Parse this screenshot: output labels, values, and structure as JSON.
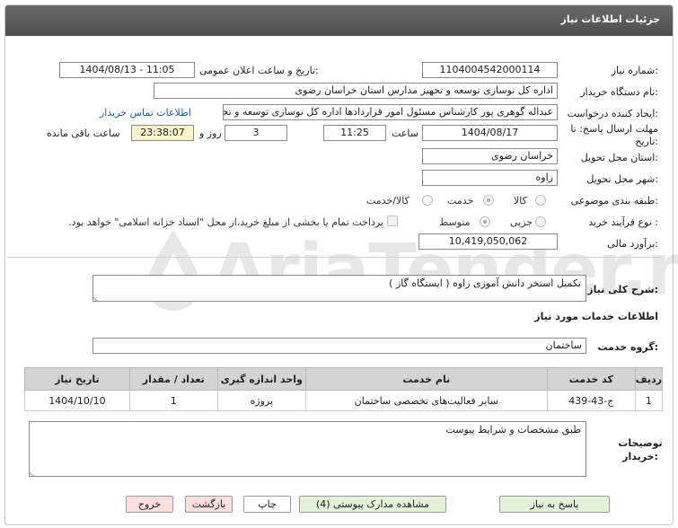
{
  "header": {
    "title": "جزئیات اطلاعات نیاز"
  },
  "form": {
    "need_number_label": "شماره نیاز:",
    "need_number": "1104004542000114",
    "announce_label": "تاریخ و ساعت اعلان عمومی:",
    "announce_value": "1404/08/13 - 11:05",
    "buyer_label": "نام دستگاه خریدار:",
    "buyer_value": "اداره کل نوسازی  توسعه و تجهیز مدارس استان خراسان رضوی",
    "creator_label": "ایجاد کننده درخواست:",
    "creator_value": "عبداله گوهری پور کارشناس مسئول امور قراردادها  اداره کل نوسازی  توسعه و تجهیز مدارس استان خراسان رضوی",
    "contact_link": "اطلاعات تماس خریدار",
    "deadline_label": "مهلت ارسال پاسخ: تا تاریخ:",
    "deadline_date": "1404/08/17",
    "time_label": "ساعت",
    "deadline_time": "11:25",
    "days_value": "3",
    "days_label": "روز و",
    "remaining_time": "23:38:07",
    "remaining_label": "ساعت باقی مانده",
    "province_label": "استان محل تحویل:",
    "province_value": "خراسان رضوی",
    "city_label": "شهر محل تحویل:",
    "city_value": "زاوه",
    "category_label": "طبقه بندی موضوعی:",
    "category_options": [
      "کالا",
      "خدمت",
      "کالا/خدمت"
    ],
    "process_label": "نوع فرآیند خرید :",
    "process_options": [
      "جزیی",
      "متوسط"
    ],
    "payment_note": "پرداخت تمام یا بخشی از مبلغ خرید،از محل \"اسناد خزانه اسلامی\" خواهد بود.",
    "estimate_label": "برآورد مالی:",
    "estimate_value": "10,419,050,062"
  },
  "need_desc": {
    "label": "شرح کلی نیاز:",
    "value": "تکمیل استخر دانش آموزی زاوه ( ایستگاه گاز )"
  },
  "services": {
    "section_title": "اطلاعات خدمات مورد نیاز",
    "group_label": "گروه خدمت:",
    "group_value": "ساختمان",
    "columns": [
      "ردیف",
      "کد خدمت",
      "نام خدمت",
      "واحد اندازه گیری",
      "تعداد / مقدار",
      "تاریخ نیاز"
    ],
    "rows": [
      [
        "1",
        "ج-43-439",
        "سایر فعالیت‌های تخصصی ساختمان",
        "پروژه",
        "1",
        "1404/10/10"
      ]
    ]
  },
  "buyer_notes": {
    "label_line1": "توضیحات",
    "label_line2": "خریدار:",
    "value": "طبق مشخصات و شرایط پیوست"
  },
  "buttons": {
    "reply": "پاسخ به نیاز",
    "attachments": "مشاهده مدارک پیوستی (4)",
    "print": "چاپ",
    "back": "بازگشت",
    "exit": "خروج"
  },
  "watermark": "AriaTender.net",
  "colors": {
    "header_bg": "#555555",
    "link": "#1a5fb4",
    "yellow_field": "#fbf4c8",
    "green_btn": "#e3f2d9",
    "red_btn": "#fbdede"
  }
}
